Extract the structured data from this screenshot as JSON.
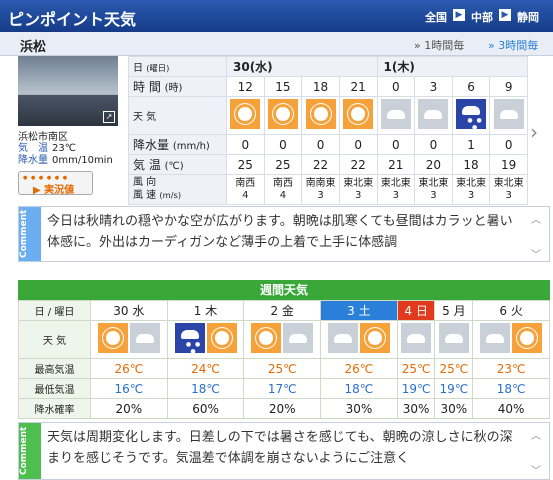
{
  "header": {
    "title": "ピンポイント天気",
    "breadcrumb": [
      "全国",
      "中部",
      "静岡"
    ],
    "sep_glyph": "▶"
  },
  "city": {
    "name": "浜松",
    "interval_1h": "1時間毎",
    "interval_3h": "3時間毎"
  },
  "camera": {
    "location": "浜松市南区",
    "temp_label": "気　温",
    "temp_value": "23℃",
    "rain_label": "降水量",
    "rain_value": "0mm/10min",
    "live_button": "実況値"
  },
  "hourly": {
    "labels": {
      "date": "日",
      "date_unit": "(曜日)",
      "time": "時 間",
      "time_unit": "(時)",
      "weather": "天 気",
      "rain": "降水量",
      "rain_unit": "(mm/h)",
      "temp": "気 温",
      "temp_unit": "(℃)",
      "wind_dir": "風 向",
      "wind_speed": "風 速",
      "wind_unit": "(m/s)"
    },
    "days": [
      "30(水)",
      "1(木)"
    ],
    "times": [
      "12",
      "15",
      "18",
      "21",
      "0",
      "3",
      "6",
      "9"
    ],
    "icons": [
      "sun-icon",
      "sun-icon",
      "sun-icon",
      "sun-icon",
      "cloud-icon",
      "cloud-icon",
      "rain-icon",
      "cloud-icon"
    ],
    "rain": [
      "0",
      "0",
      "0",
      "0",
      "0",
      "0",
      "1",
      "0"
    ],
    "temp": [
      "25",
      "25",
      "22",
      "22",
      "21",
      "20",
      "18",
      "19"
    ],
    "wind_dir": [
      "南西",
      "南西",
      "南南東",
      "東北東",
      "東北東",
      "東北東",
      "東北東",
      "東北東"
    ],
    "wind_speed": [
      "4",
      "4",
      "3",
      "3",
      "3",
      "3",
      "3",
      "3"
    ]
  },
  "comment1": {
    "tag": "Comment",
    "text": "今日は秋晴れの穏やかな空が広がります。朝晩は肌寒くても昼間はカラッと暑い体感に。外出はカーディガンなど薄手の上着で上手に体感調"
  },
  "weekly": {
    "title": "週間天気",
    "labels": {
      "date": "日 / 曜日",
      "weather": "天 気",
      "hi": "最高気温",
      "lo": "最低気温",
      "pop": "降水確率"
    },
    "days": [
      "30 水",
      "1 木",
      "2 金",
      "3 土",
      "4 日",
      "5 月",
      "6 火"
    ],
    "hi": [
      "26℃",
      "24℃",
      "25℃",
      "26℃",
      "25℃",
      "25℃",
      "23℃"
    ],
    "lo": [
      "16℃",
      "18℃",
      "17℃",
      "18℃",
      "19℃",
      "19℃",
      "18℃"
    ],
    "pop": [
      "20%",
      "60%",
      "20%",
      "30%",
      "30%",
      "30%",
      "40%"
    ]
  },
  "comment2": {
    "tag": "Comment",
    "text": "天気は周期変化します。日差しの下では暑さを感じても、朝晩の涼しさに秋の深まりを感じそうです。気温差で体調を崩さないようにご注意く"
  },
  "colors": {
    "header_blue": "#163c88",
    "sun_orange": "#f6a23a",
    "week_green": "#39a839",
    "saturday_blue": "#2a7fd8",
    "sunday_red": "#e23a1c"
  }
}
